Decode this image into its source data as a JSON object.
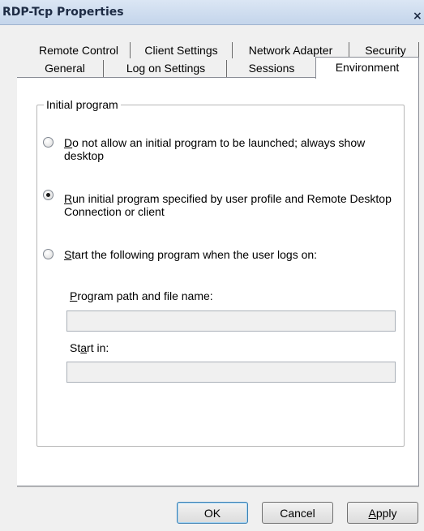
{
  "window": {
    "title": "RDP-Tcp Properties",
    "close_glyph": "×"
  },
  "tabs": {
    "row1": [
      "Remote Control",
      "Client Settings",
      "Network Adapter",
      "Security"
    ],
    "row2": [
      "General",
      "Log on Settings",
      "Sessions",
      "Environment"
    ],
    "selected": "Environment"
  },
  "group": {
    "legend": "Initial program"
  },
  "options": [
    {
      "mnemonic": "D",
      "line1_rest": "o not allow an initial program to be launched; always show",
      "line2": "desktop",
      "checked": false
    },
    {
      "mnemonic": "R",
      "line1_rest": "un initial program specified by user profile and Remote Desktop",
      "line2": "Connection or client",
      "checked": true
    },
    {
      "mnemonic": "S",
      "line1_rest": "tart the following program when the user logs on:",
      "line2": "",
      "checked": false
    }
  ],
  "fields": {
    "program_path": {
      "mnemonic": "P",
      "label_rest": "rogram path and file name:",
      "value": ""
    },
    "start_in": {
      "label_pre": "St",
      "mnemonic": "a",
      "label_rest": "rt in:",
      "value": ""
    }
  },
  "buttons": {
    "ok": "OK",
    "cancel": "Cancel",
    "apply_mnemonic": "A",
    "apply_rest": "pply"
  }
}
